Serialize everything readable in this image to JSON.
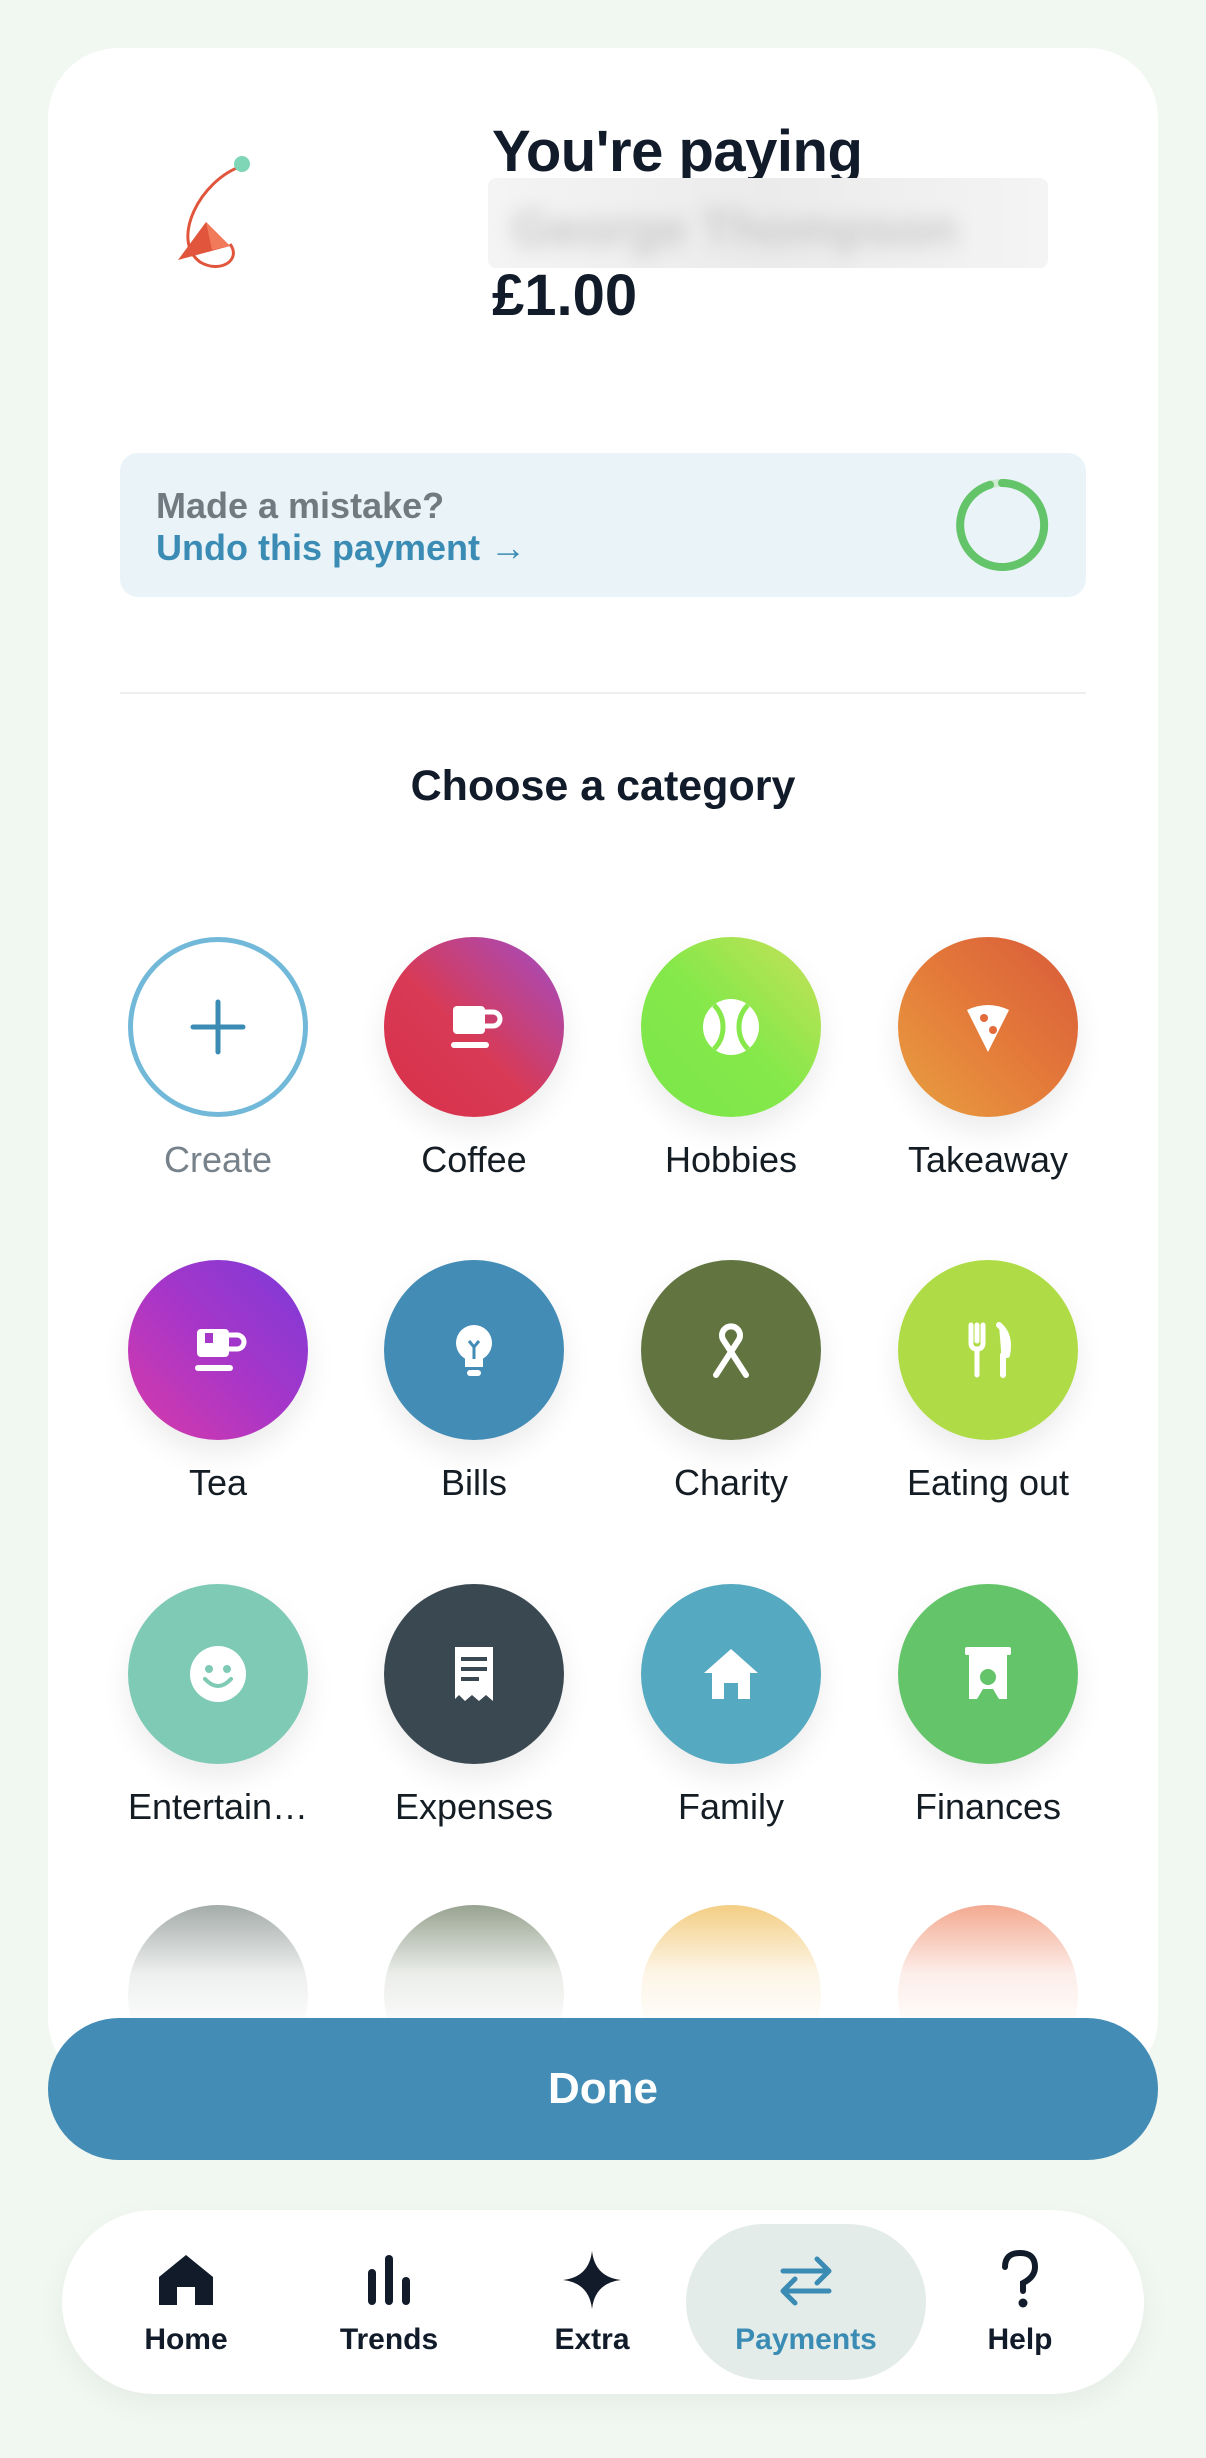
{
  "payment": {
    "title": "You're paying",
    "payee_redacted": "George Thompson",
    "amount": "£1.00"
  },
  "undo": {
    "question": "Made a mistake?",
    "link_label": "Undo this payment →"
  },
  "category_section": {
    "heading": "Choose a category"
  },
  "categories": [
    {
      "label": "Create",
      "icon": "plus-icon",
      "color": "#ffffff"
    },
    {
      "label": "Coffee",
      "icon": "coffee-cup-icon",
      "color": "#d0344a"
    },
    {
      "label": "Hobbies",
      "icon": "tennis-ball-icon",
      "color": "#7fe84a"
    },
    {
      "label": "Takeaway",
      "icon": "pizza-slice-icon",
      "color": "#e46a3a"
    },
    {
      "label": "Tea",
      "icon": "tea-cup-icon",
      "color": "#a02fd0"
    },
    {
      "label": "Bills",
      "icon": "lightbulb-icon",
      "color": "#438cb6"
    },
    {
      "label": "Charity",
      "icon": "ribbon-icon",
      "color": "#627541"
    },
    {
      "label": "Eating out",
      "icon": "cutlery-icon",
      "color": "#afdc46"
    },
    {
      "label": "Entertain…",
      "icon": "smiley-icon",
      "color": "#7ecab4"
    },
    {
      "label": "Expenses",
      "icon": "receipt-icon",
      "color": "#3a4851"
    },
    {
      "label": "Family",
      "icon": "house-icon",
      "color": "#55a9c0"
    },
    {
      "label": "Finances",
      "icon": "piggy-bank-icon",
      "color": "#63c46a"
    }
  ],
  "done_label": "Done",
  "nav": [
    {
      "label": "Home",
      "icon": "home-icon"
    },
    {
      "label": "Trends",
      "icon": "bar-chart-icon"
    },
    {
      "label": "Extra",
      "icon": "sparkle-icon"
    },
    {
      "label": "Payments",
      "icon": "transfer-arrows-icon",
      "active": true
    },
    {
      "label": "Help",
      "icon": "question-mark-icon"
    }
  ],
  "colors": {
    "accent": "#438cb6",
    "undo_timer": "#63c46a",
    "background": "#f1f7f1"
  }
}
